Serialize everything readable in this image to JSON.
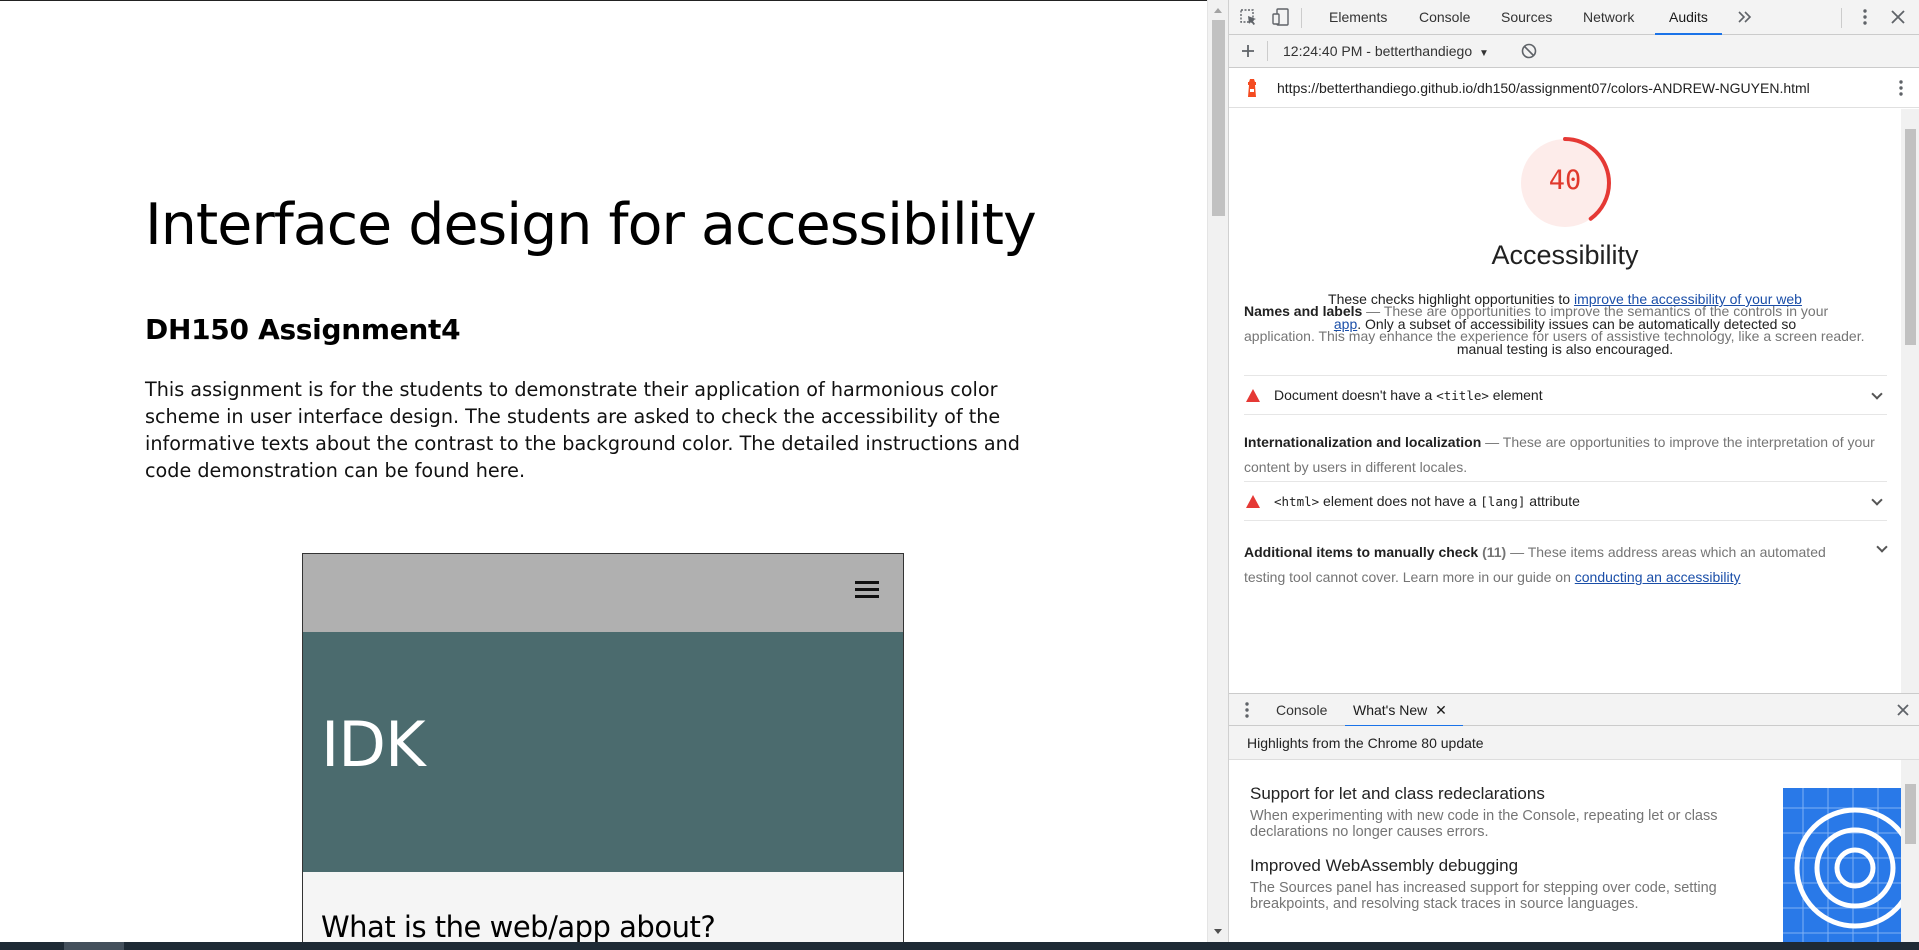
{
  "page": {
    "title": "Interface design for accessibility",
    "subtitle": "DH150 Assignment4",
    "paragraph": "This assignment is for the students to demonstrate their application of harmonious color scheme in user interface design. The students are asked to check the accessibility of the informative texts about the contrast to the background color. The detailed instructions and code demonstration can be found here.",
    "mock": {
      "hero_title": "IDK",
      "section_heading": "What is the web/app about?",
      "nav_color": "#b0b0b0",
      "hero_color": "#4b6b6e"
    }
  },
  "devtools": {
    "tabs": [
      "Elements",
      "Console",
      "Sources",
      "Network",
      "Audits"
    ],
    "active_tab": "Audits",
    "report_selector": "12:24:40 PM - betterthandiego",
    "url": "https://betterthandiego.github.io/dh150/assignment07/colors-ANDREW-NGUYEN.html",
    "audit": {
      "score": "40",
      "score_color": "#e0392d",
      "category": "Accessibility",
      "description_pre": "These checks highlight opportunities to ",
      "description_link": "improve the accessibility of your web app",
      "description_post": ". Only a subset of accessibility issues can be automatically detected so manual testing is also encouraged.",
      "groups": [
        {
          "title": "Names and labels",
          "description": "These are opportunities to improve the semantics of the controls in your application. This may enhance the experience for users of assistive technology, like a screen reader.",
          "audit_pre": "Document doesn't have a ",
          "audit_code": "<title>",
          "audit_post": " element"
        },
        {
          "title": "Internationalization and localization",
          "description": "These are opportunities to improve the interpretation of your content by users in different locales.",
          "audit_code": "<html>",
          "audit_mid": " element does not have a ",
          "audit_code2": "[lang]",
          "audit_post": " attribute"
        },
        {
          "title": "Additional items to manually check",
          "count": "(11)",
          "description": "These items address areas which an automated testing tool cannot cover. Learn more in our guide on ",
          "link": "conducting an accessibility"
        }
      ]
    },
    "drawer": {
      "tabs": [
        "Console",
        "What's New"
      ],
      "active_tab": "What's New",
      "header": "Highlights from the Chrome 80 update",
      "items": [
        {
          "title": "Support for let and class redeclarations",
          "description": "When experimenting with new code in the Console, repeating let or class declarations no longer causes errors."
        },
        {
          "title": "Improved WebAssembly debugging",
          "description": "The Sources panel has increased support for stepping over code, setting breakpoints, and resolving stack traces in source languages."
        }
      ]
    },
    "accent_color": "#1a73e8"
  }
}
